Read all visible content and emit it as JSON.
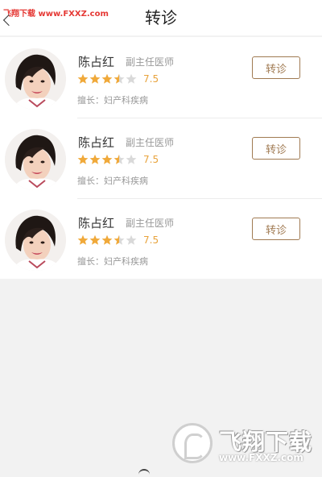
{
  "watermark": {
    "top_text": "飞翔下载 www.FXXZ.com",
    "brand": "飞翔下载",
    "url": "www.FXXZ.com"
  },
  "header": {
    "title": "转诊"
  },
  "doctors": [
    {
      "name": "陈占红",
      "rank": "副主任医师",
      "score": "7.5",
      "rating": 3.5,
      "specialty": "擅长：妇产科疾病",
      "action": "转诊"
    },
    {
      "name": "陈占红",
      "rank": "副主任医师",
      "score": "7.5",
      "rating": 3.5,
      "specialty": "擅长：妇产科疾病",
      "action": "转诊"
    },
    {
      "name": "陈占红",
      "rank": "副主任医师",
      "score": "7.5",
      "rating": 3.5,
      "specialty": "擅长：妇产科疾病",
      "action": "转诊"
    }
  ],
  "colors": {
    "star": "#f0a93a",
    "star_empty": "#d9d9d9",
    "accent": "#a07a52"
  },
  "icons": {
    "back": "back-arrow-icon",
    "star": "star-icon",
    "avatar": "doctor-avatar"
  }
}
